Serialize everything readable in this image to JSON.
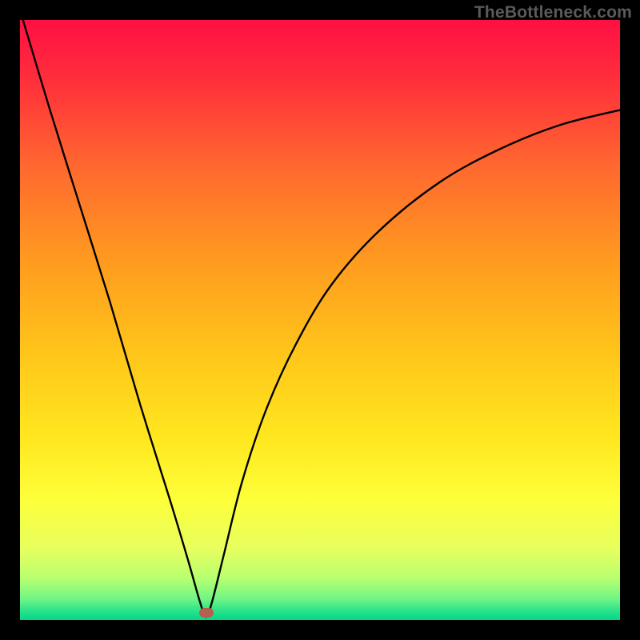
{
  "watermark": "TheBottleneck.com",
  "colors": {
    "frame": "#000000",
    "gradient_stops": [
      {
        "offset": 0.0,
        "color": "#ff0f43"
      },
      {
        "offset": 0.1,
        "color": "#ff2f3b"
      },
      {
        "offset": 0.25,
        "color": "#ff6a2f"
      },
      {
        "offset": 0.4,
        "color": "#ff9a1f"
      },
      {
        "offset": 0.55,
        "color": "#ffc41a"
      },
      {
        "offset": 0.7,
        "color": "#ffe81f"
      },
      {
        "offset": 0.8,
        "color": "#fdff3a"
      },
      {
        "offset": 0.88,
        "color": "#e8ff5e"
      },
      {
        "offset": 0.93,
        "color": "#b8ff70"
      },
      {
        "offset": 0.965,
        "color": "#70f585"
      },
      {
        "offset": 0.985,
        "color": "#28e38a"
      },
      {
        "offset": 1.0,
        "color": "#06d68a"
      }
    ],
    "curve": "#000000",
    "marker": "#b6604f"
  },
  "chart_data": {
    "type": "line",
    "title": "",
    "xlabel": "",
    "ylabel": "",
    "xlim": [
      0,
      100
    ],
    "ylim": [
      0,
      100
    ],
    "note": "V-shaped bottleneck curve: linear descent from top-left to a minimum near x≈31, then an asymptotic rise toward the right edge. Values are read from the plotted curve (y = 0 at bottom, 100 at top).",
    "minimum_x": 31,
    "marker": {
      "x": 31,
      "y": 1.2
    },
    "series": [
      {
        "name": "bottleneck-curve",
        "points": [
          {
            "x": 0.5,
            "y": 100
          },
          {
            "x": 5,
            "y": 85
          },
          {
            "x": 10,
            "y": 69
          },
          {
            "x": 15,
            "y": 53
          },
          {
            "x": 20,
            "y": 36
          },
          {
            "x": 25,
            "y": 20
          },
          {
            "x": 28,
            "y": 10
          },
          {
            "x": 30,
            "y": 3
          },
          {
            "x": 31,
            "y": 0.5
          },
          {
            "x": 32,
            "y": 3
          },
          {
            "x": 34,
            "y": 11
          },
          {
            "x": 37,
            "y": 23
          },
          {
            "x": 41,
            "y": 35
          },
          {
            "x": 46,
            "y": 46
          },
          {
            "x": 52,
            "y": 56
          },
          {
            "x": 60,
            "y": 65
          },
          {
            "x": 70,
            "y": 73
          },
          {
            "x": 80,
            "y": 78.5
          },
          {
            "x": 90,
            "y": 82.5
          },
          {
            "x": 100,
            "y": 85
          }
        ]
      }
    ]
  }
}
